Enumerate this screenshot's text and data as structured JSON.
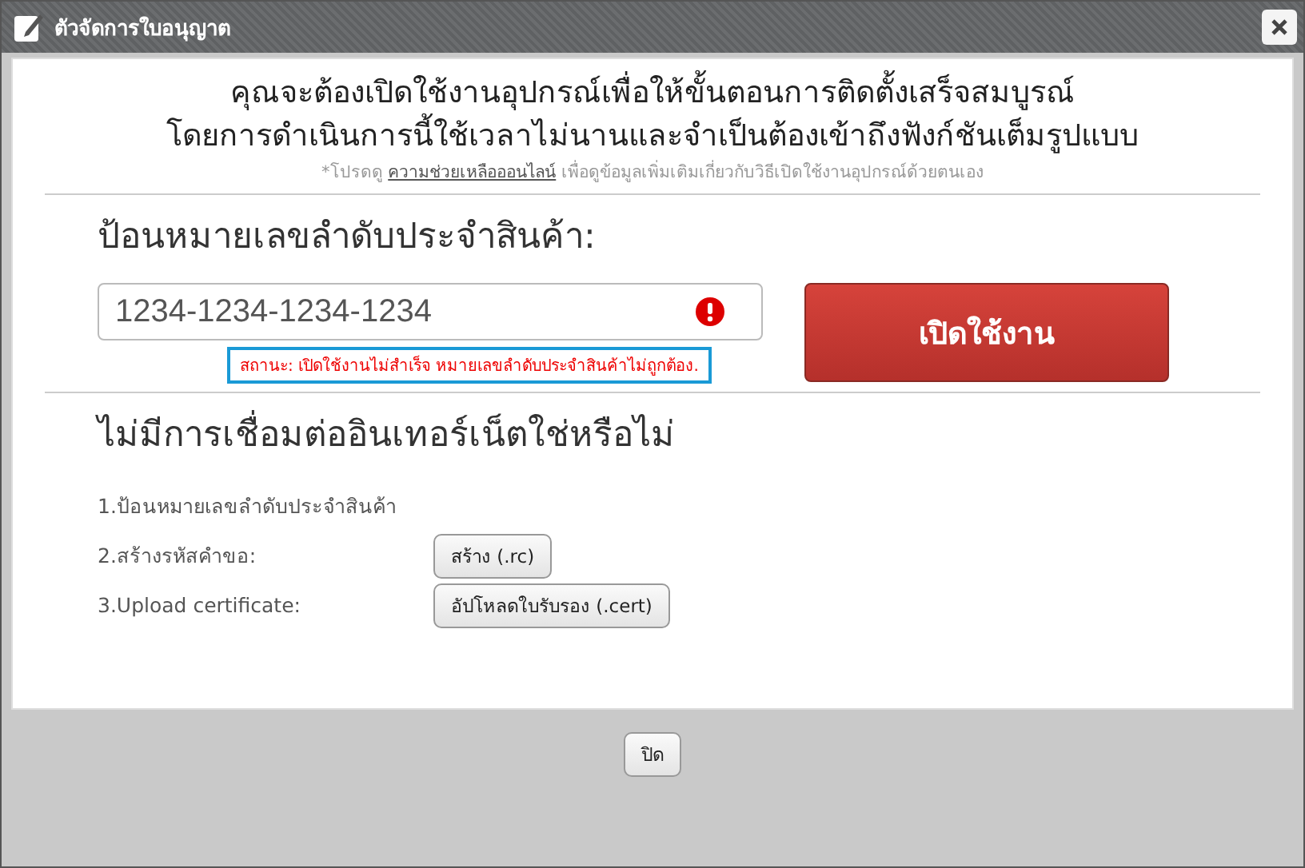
{
  "window": {
    "title": "ตัวจัดการใบอนุญาต"
  },
  "intro": {
    "lines": [
      "คุณจะต้องเปิดใช้งานอุปกรณ์เพื่อให้ขั้นตอนการติดตั้งเสร็จสมบูรณ์",
      "โดยการดำเนินการนี้ใช้เวลาไม่นานและจำเป็นต้องเข้าถึงฟังก์ชันเต็มรูปแบบ"
    ],
    "note_prefix": "*โปรดดู",
    "note_link": "ความช่วยเหลือออนไลน์",
    "note_suffix": "เพื่อดูข้อมูลเพิ่มเติมเกี่ยวกับวิธีเปิดใช้งานอุปกรณ์ด้วยตนเอง"
  },
  "serial": {
    "heading": "ป้อนหมายเลขลำดับประจำสินค้า:",
    "value": "1234-1234-1234-1234",
    "error": true,
    "status": "สถานะ: เปิดใช้งานไม่สำเร็จ หมายเลขลำดับประจำสินค้าไม่ถูกต้อง.",
    "button": "เปิดใช้งาน"
  },
  "offline": {
    "heading": "ไม่มีการเชื่อมต่ออินเทอร์เน็ตใช่หรือไม่",
    "steps": [
      {
        "label": "1.ป้อนหมายเลขลำดับประจำสินค้า"
      },
      {
        "label": "2.สร้างรหัสคำขอ:",
        "button": "สร้าง (.rc)"
      },
      {
        "label": "3.Upload certificate:",
        "button": "อัปโหลดใบรับรอง (.cert)"
      }
    ]
  },
  "footer": {
    "button": "ปิด"
  }
}
